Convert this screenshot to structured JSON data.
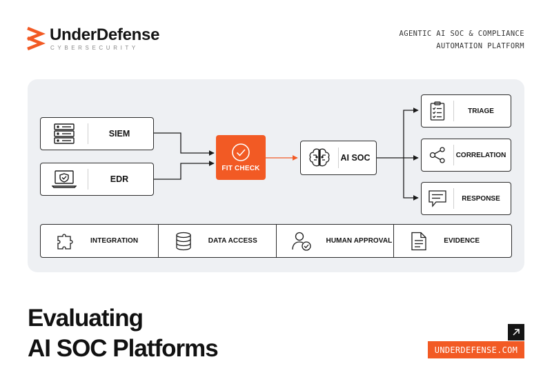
{
  "brand": {
    "name": "UnderDefense",
    "sub": "CYBERSECURITY",
    "accent_color": "#f25a24",
    "logo_icon": "chevron-stack-icon"
  },
  "tagline": {
    "line1": "AGENTIC AI SOC & COMPLIANCE",
    "line2": "AUTOMATION PLATFORM"
  },
  "diagram": {
    "sources": [
      {
        "label": "SIEM",
        "icon": "server-rack-icon"
      },
      {
        "label": "EDR",
        "icon": "laptop-shield-icon"
      }
    ],
    "fit_check": {
      "label": "FIT CHECK",
      "icon": "check-circle-icon"
    },
    "ai_soc": {
      "label": "AI SOC",
      "icon": "brain-circuit-icon"
    },
    "outputs": [
      {
        "label": "TRIAGE",
        "icon": "clipboard-list-icon"
      },
      {
        "label": "CORRELATION",
        "icon": "share-nodes-icon"
      },
      {
        "label": "RESPONSE",
        "icon": "chat-bubble-icon"
      }
    ],
    "capabilities": [
      {
        "label": "INTEGRATION",
        "icon": "puzzle-icon"
      },
      {
        "label": "DATA ACCESS",
        "icon": "database-icon"
      },
      {
        "label": "HUMAN APPROVAL",
        "icon": "user-check-icon"
      },
      {
        "label": "EVIDENCE",
        "icon": "document-icon"
      }
    ]
  },
  "headline": {
    "line1": "Evaluating",
    "line2": "AI SOC Platforms"
  },
  "footer": {
    "url": "UNDERDEFENSE.COM",
    "link_icon": "arrow-up-right-icon"
  }
}
